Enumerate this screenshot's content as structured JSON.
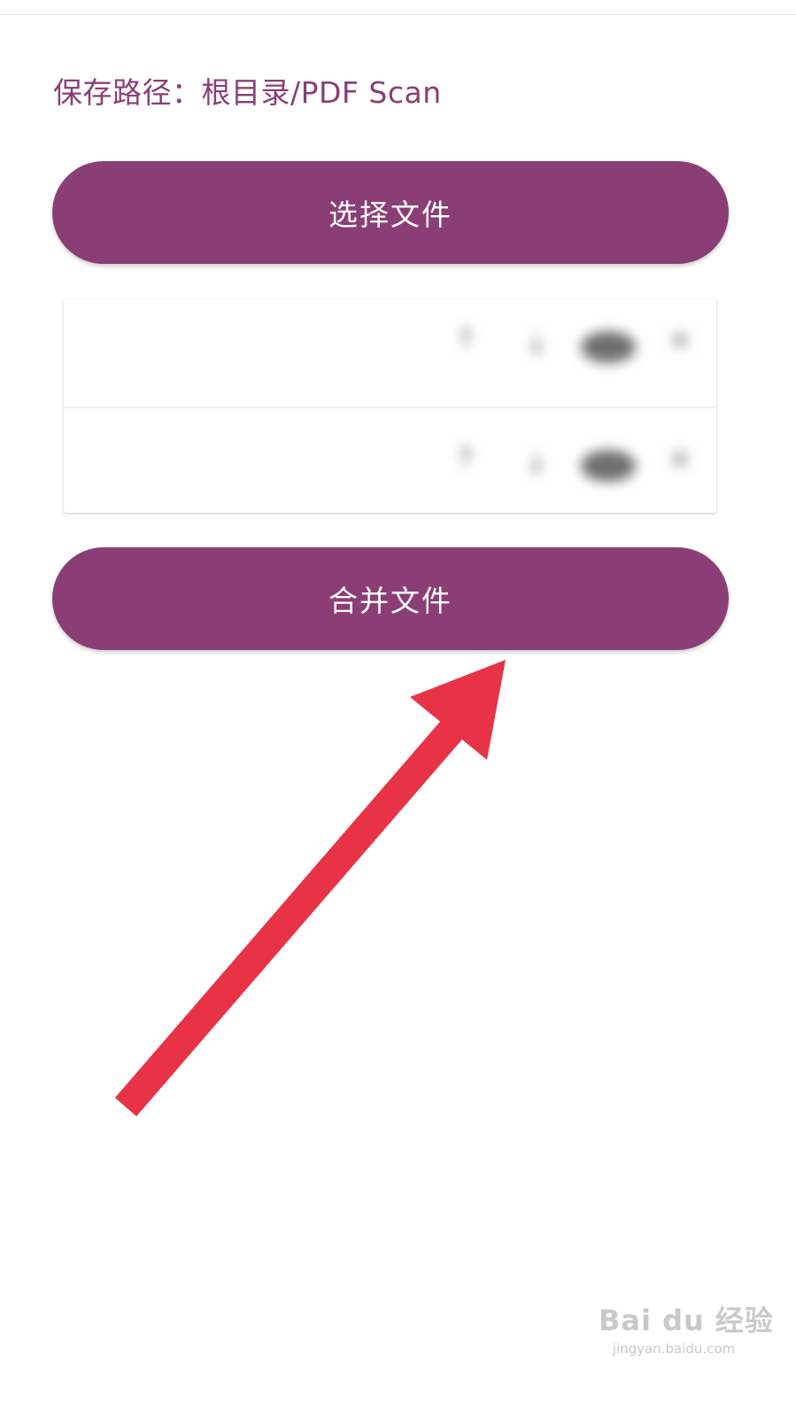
{
  "colors": {
    "accent": "#8a3e75",
    "button": "#8a3e75",
    "button_text": "#ffffff",
    "annotation_arrow": "#e83346"
  },
  "save_path": {
    "label": "保存路径：根目录/PDF Scan"
  },
  "buttons": {
    "select_files": "选择文件",
    "merge_files": "合并文件"
  },
  "file_list": {
    "items": [
      {
        "name": "",
        "icons": [
          "move-up-icon",
          "move-down-icon",
          "preview-icon",
          "remove-icon"
        ]
      },
      {
        "name": "",
        "icons": [
          "move-up-icon",
          "move-down-icon",
          "preview-icon",
          "remove-icon"
        ]
      }
    ]
  },
  "watermark": {
    "logo": "Bai du 经验",
    "url": "jingyan.baidu.com"
  }
}
